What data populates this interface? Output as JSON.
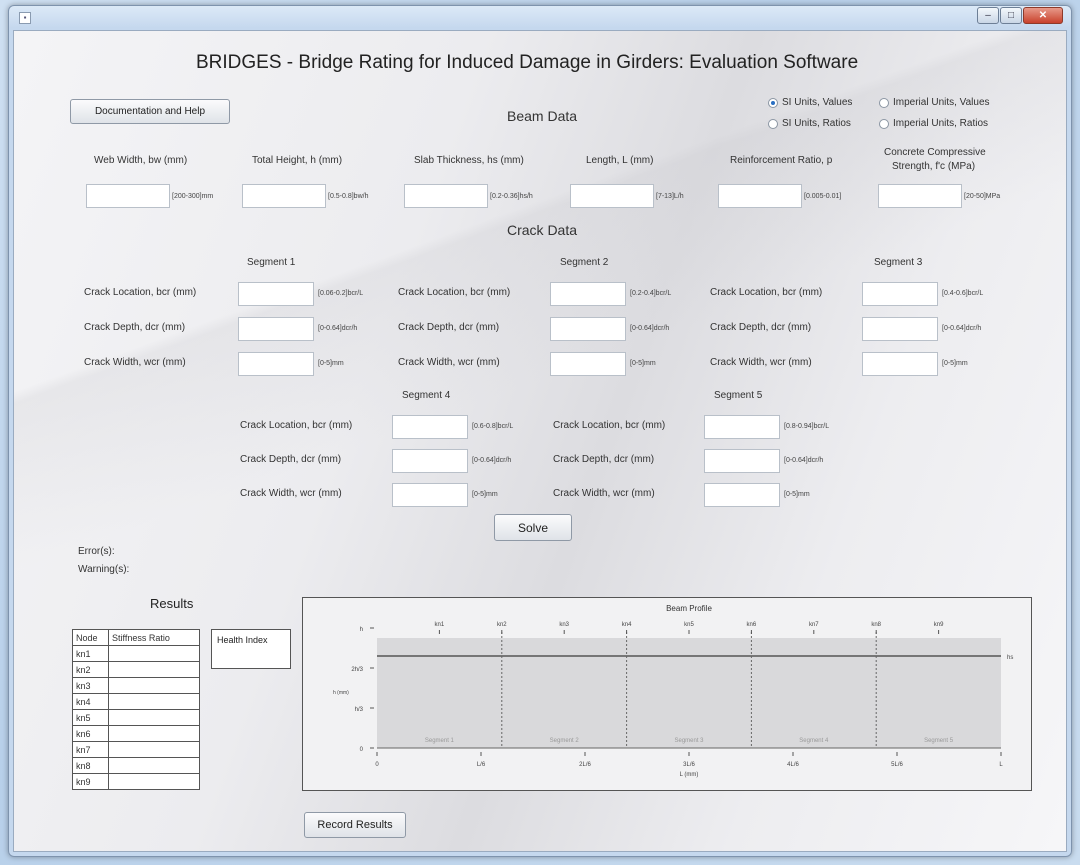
{
  "app": {
    "title": "BRIDGES - Bridge Rating for Induced Damage in Girders: Evaluation Software",
    "help_button": "Documentation and Help",
    "icon": "app-window-icon"
  },
  "window_controls": {
    "minimize": "–",
    "maximize": "□",
    "close": "✕"
  },
  "units": {
    "si_values": "SI Units, Values",
    "imperial_values": "Imperial Units, Values",
    "si_ratios": "SI Units, Ratios",
    "imperial_ratios": "Imperial Units, Ratios",
    "selected": "si_values"
  },
  "beam": {
    "title": "Beam Data",
    "fields": [
      {
        "label": "Web Width, bw (mm)",
        "hint": "[200-300]mm",
        "value": ""
      },
      {
        "label": "Total Height, h (mm)",
        "hint": "[0.5-0.8]bw/h",
        "value": ""
      },
      {
        "label": "Slab Thickness, hs (mm)",
        "hint": "[0.2-0.36]hs/h",
        "value": ""
      },
      {
        "label": "Length, L (mm)",
        "hint": "[7-13]L/h",
        "value": ""
      },
      {
        "label": "Reinforcement Ratio, p",
        "hint": "[0.005-0.01]",
        "value": ""
      },
      {
        "label": "Concrete Compressive",
        "label2": "Strength, f'c (MPa)",
        "hint": "[20-50]MPa",
        "value": ""
      }
    ]
  },
  "crack": {
    "title": "Crack Data",
    "row_labels": [
      "Crack Location, bcr (mm)",
      "Crack Depth, dcr (mm)",
      "Crack Width, wcr (mm)"
    ],
    "segments": [
      {
        "name": "Segment 1",
        "hints": [
          "[0.06-0.2]bcr/L",
          "[0-0.64]dcr/h",
          "[0-5]mm"
        ]
      },
      {
        "name": "Segment 2",
        "hints": [
          "[0.2-0.4]bcr/L",
          "[0-0.64]dcr/h",
          "[0-5]mm"
        ]
      },
      {
        "name": "Segment 3",
        "hints": [
          "[0.4-0.6]bcr/L",
          "[0-0.64]dcr/h",
          "[0-5]mm"
        ]
      },
      {
        "name": "Segment 4",
        "hints": [
          "[0.6-0.8]bcr/L",
          "[0-0.64]dcr/h",
          "[0-5]mm"
        ]
      },
      {
        "name": "Segment 5",
        "hints": [
          "[0.8-0.94]bcr/L",
          "[0-0.64]dcr/h",
          "[0-5]mm"
        ]
      }
    ]
  },
  "solve_button": "Solve",
  "messages": {
    "errors": "Error(s):",
    "warnings": "Warning(s):"
  },
  "results": {
    "title": "Results",
    "headers": [
      "Node",
      "Stiffness Ratio"
    ],
    "nodes": [
      "kn1",
      "kn2",
      "kn3",
      "kn4",
      "kn5",
      "kn6",
      "kn7",
      "kn8",
      "kn9"
    ],
    "health_index": "Health Index"
  },
  "record_button": "Record Results",
  "chart_data": {
    "type": "line",
    "title": "Beam Profile",
    "xlabel": "L (mm)",
    "ylabel": "h (mm)",
    "x_ticks": [
      "0",
      "L/6",
      "2L/6",
      "3L/6",
      "4L/6",
      "5L/6",
      "L"
    ],
    "y_ticks": [
      "0",
      "h/3",
      "2h/3",
      "h"
    ],
    "top_label": "hs",
    "nodes": [
      "kn1",
      "kn2",
      "kn3",
      "kn4",
      "kn5",
      "kn6",
      "kn7",
      "kn8",
      "kn9"
    ],
    "segment_labels": [
      "Segment 1",
      "Segment 2",
      "Segment 3",
      "Segment 4",
      "Segment 5"
    ],
    "grid": false
  }
}
